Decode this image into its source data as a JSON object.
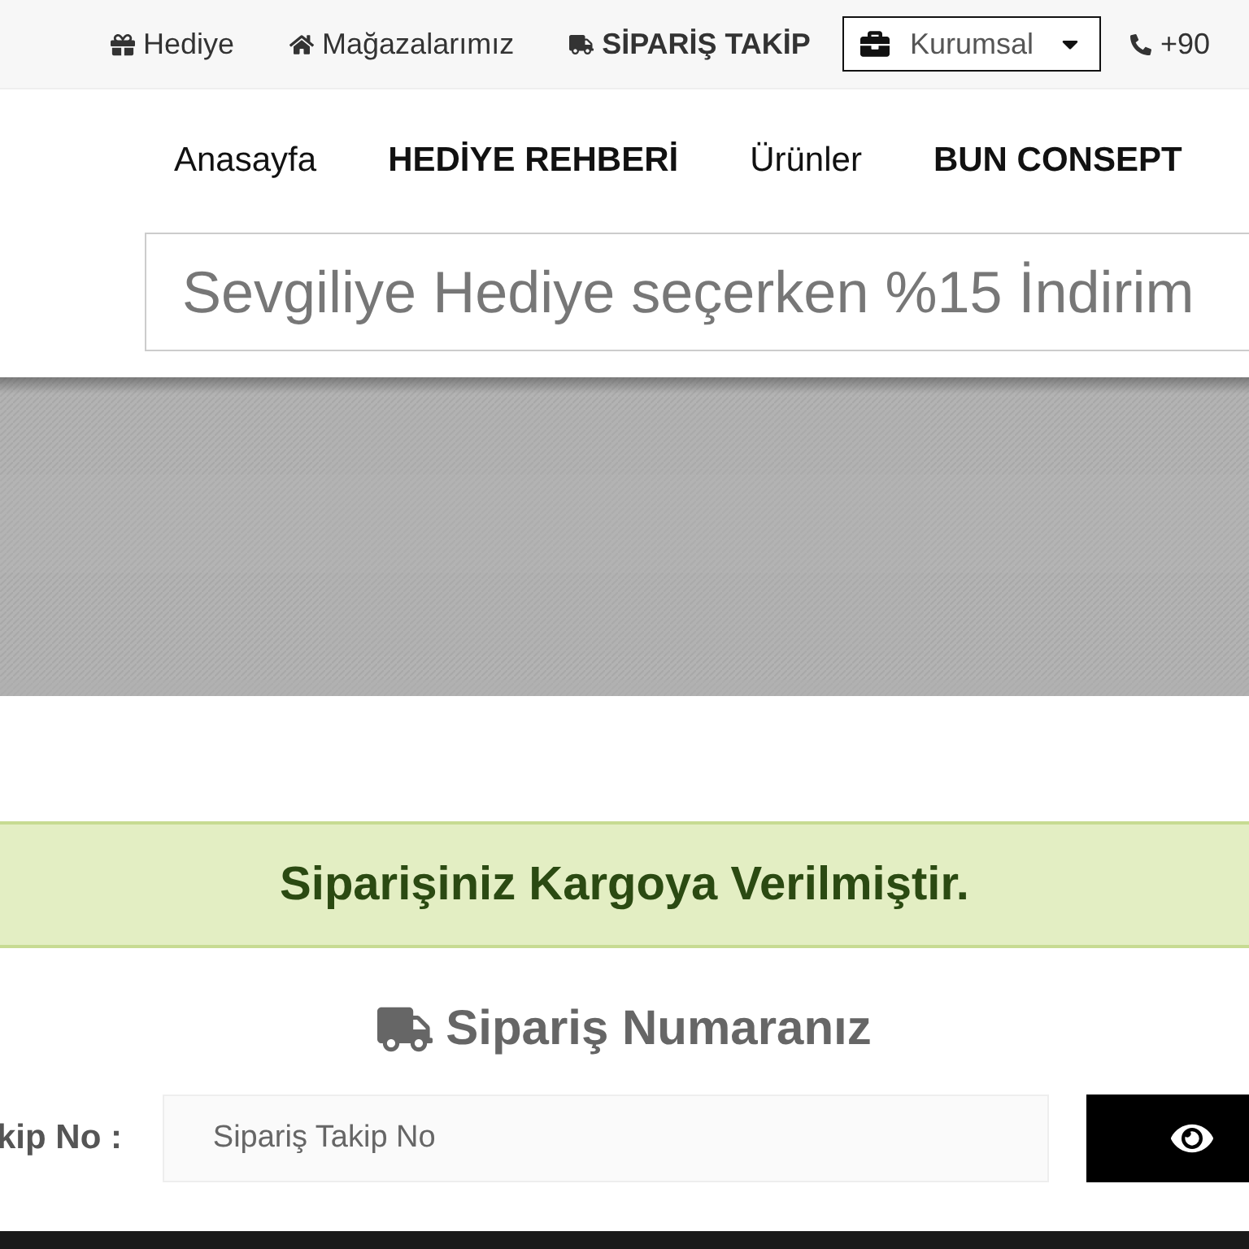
{
  "top_bar": {
    "links": [
      {
        "kind": "gift",
        "label": "Hediye",
        "bold": false
      },
      {
        "kind": "home",
        "label": "Mağazalarımız",
        "bold": false
      },
      {
        "kind": "truck",
        "label": "SİPARİŞ TAKİP",
        "bold": true
      }
    ],
    "dropdown": {
      "label": "Kurumsal"
    },
    "phone": "+90"
  },
  "main_nav": [
    {
      "label": "Anasayfa",
      "bold": false
    },
    {
      "label": "HEDİYE REHBERİ",
      "bold": true
    },
    {
      "label": "Ürünler",
      "bold": false
    },
    {
      "label": "BUN CONSEPT",
      "bold": true
    }
  ],
  "search": {
    "placeholder": "Sevgiliye Hediye seçerken %15 İndirim"
  },
  "alert": {
    "message": "Siparişiniz Kargoya Verilmiştir."
  },
  "tracking": {
    "heading": "Sipariş Numaranız",
    "label": "kip No :",
    "input": {
      "placeholder": "Sipariş Takip No"
    }
  }
}
